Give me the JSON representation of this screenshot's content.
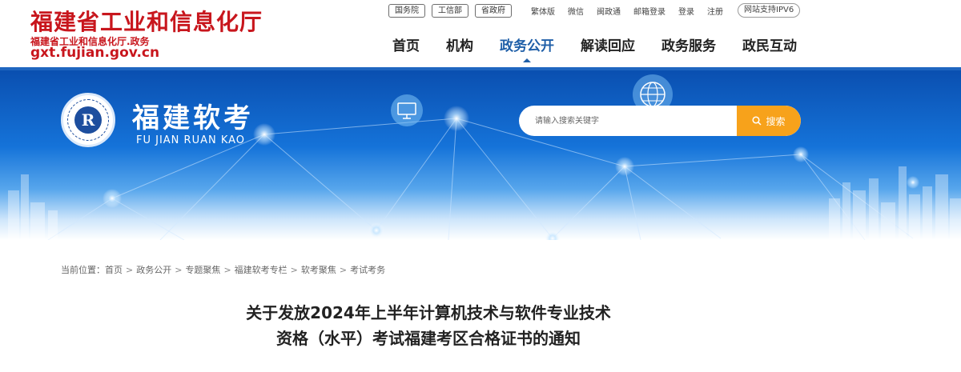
{
  "header": {
    "logo": {
      "title": "福建省工业和信息化厅",
      "subtitle": "福建省工业和信息化厅.政务",
      "domain": "gxt.fujian.gov.cn"
    },
    "gov_links": [
      "国务院",
      "工信部",
      "省政府"
    ],
    "util_links": [
      "繁体版",
      "微信",
      "闽政通",
      "邮箱登录",
      "登录",
      "注册"
    ],
    "ipv6_label": "网站支持IPV6",
    "nav": [
      {
        "label": "首页"
      },
      {
        "label": "机构"
      },
      {
        "label": "政务公开",
        "active": true
      },
      {
        "label": "解读回应"
      },
      {
        "label": "政务服务"
      },
      {
        "label": "政民互动"
      }
    ],
    "accent_color": "#1f66c0",
    "logo_color": "#c8161d"
  },
  "banner": {
    "title": "福建软考",
    "subtitle": "FU JIAN RUAN KAO",
    "emblem_letter": "R",
    "search": {
      "placeholder": "请输入搜索关键字",
      "button_label": "搜索",
      "button_color": "#f7a21b"
    }
  },
  "breadcrumb": {
    "prefix": "当前位置：",
    "items": [
      "首页",
      "政务公开",
      "专题聚焦",
      "福建软考专栏",
      "软考聚焦",
      "考试考务"
    ],
    "separator": ">"
  },
  "article": {
    "title_line1": "关于发放2024年上半年计算机技术与软件专业技术",
    "title_line2": "资格（水平）考试福建考区合格证书的通知"
  }
}
